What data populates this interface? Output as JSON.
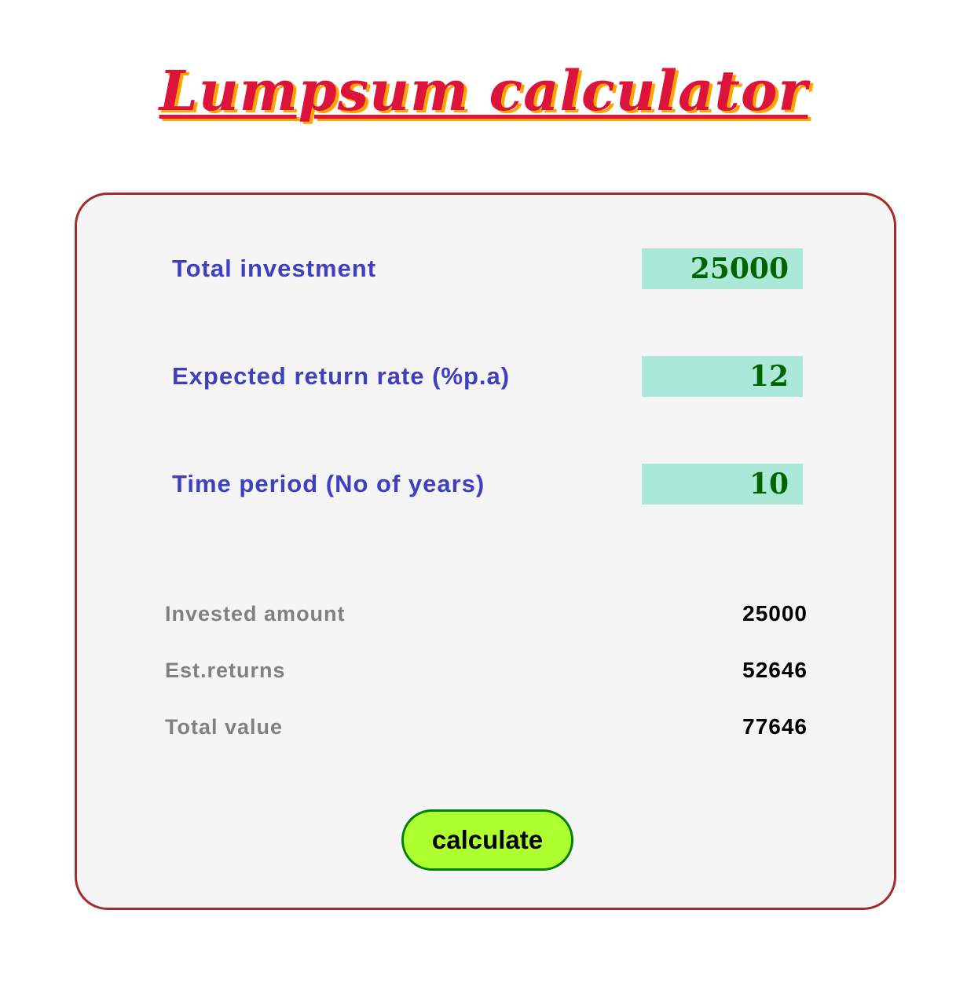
{
  "title": "Lumpsum calculator",
  "colors": {
    "title": "#dc143c",
    "title_shadow": "#ffa500",
    "card_border": "#a52a2a",
    "card_background": "#f5f5f5",
    "input_label": "#3f3fbf",
    "input_background": "#abe8d8",
    "input_text": "#006400",
    "result_label": "#808080",
    "result_value": "#000000",
    "button_background": "#adff2f",
    "button_border": "#008000"
  },
  "inputs": [
    {
      "label": "Total investment",
      "value": "25000"
    },
    {
      "label": "Expected return rate (%p.a)",
      "value": "12"
    },
    {
      "label": "Time period (No of years)",
      "value": "10"
    }
  ],
  "results": [
    {
      "label": "Invested amount",
      "value": "25000"
    },
    {
      "label": "Est.returns",
      "value": "52646"
    },
    {
      "label": "Total value",
      "value": "77646"
    }
  ],
  "button": {
    "label": "calculate"
  }
}
